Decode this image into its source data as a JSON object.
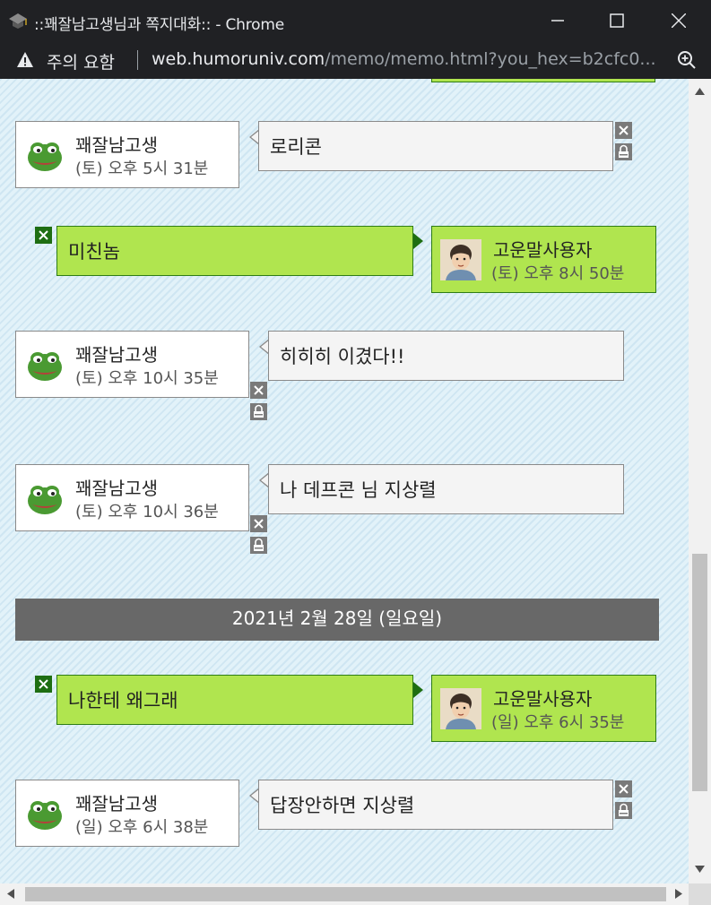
{
  "window": {
    "title": "::꽤잘남고생님과 쪽지대화:: - Chrome"
  },
  "address": {
    "warning": "주의 요함",
    "host": "web.humoruniv.com",
    "path": "/memo/memo.html?you_hex=b2cfc0..."
  },
  "messages": [
    {
      "side": "left",
      "name": "꽤잘남고생",
      "time": "(토) 오후 5시 31분",
      "text": "로리콘"
    },
    {
      "side": "right",
      "name": "고운말사용자",
      "time": "(토) 오후 8시 50분",
      "text": "미친놈"
    },
    {
      "side": "left",
      "name": "꽤잘남고생",
      "time": "(토) 오후 10시 35분",
      "text": "히히히 이겼다!!"
    },
    {
      "side": "left",
      "name": "꽤잘남고생",
      "time": "(토) 오후 10시 36분",
      "text": "나 데프콘 님 지상렬"
    },
    {
      "side": "right",
      "name": "고운말사용자",
      "time": "(일) 오후 6시 35분",
      "text": "나한테 왜그래"
    },
    {
      "side": "left",
      "name": "꽤잘남고생",
      "time": "(일) 오후 6시 38분",
      "text": "답장안하면 지상렬"
    }
  ],
  "date_divider": "2021년 2월 28일 (일요일)",
  "colors": {
    "my_bubble": "#b0e54f",
    "my_border": "#2f7d16",
    "their_bubble": "#f4f4f4",
    "divider": "#686868"
  }
}
